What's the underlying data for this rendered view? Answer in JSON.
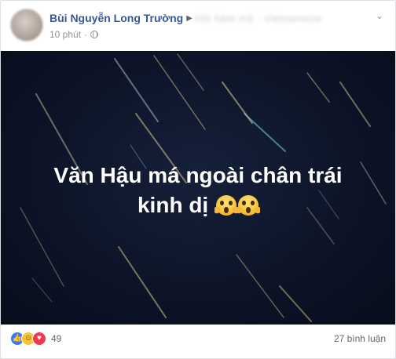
{
  "post": {
    "author": "Bùi Nguyễn Long Trường",
    "group_name": "Hội hâm mộ - Vietnamese",
    "time": "10 phút",
    "privacy_icon": "globe-icon",
    "menu_icon": "chevron-down-icon",
    "image_text_line1": "Văn Hậu má ngoài chân trái",
    "image_text_line2": "kinh dị",
    "image_emoji": "😱😱",
    "reaction_icons": [
      "like-icon",
      "haha-icon",
      "love-icon"
    ],
    "reaction_count": "49",
    "comments_label": "27 bình luận"
  },
  "colors": {
    "author": "#365899",
    "image_bg": "#0d1428",
    "meta": "#90949c"
  }
}
